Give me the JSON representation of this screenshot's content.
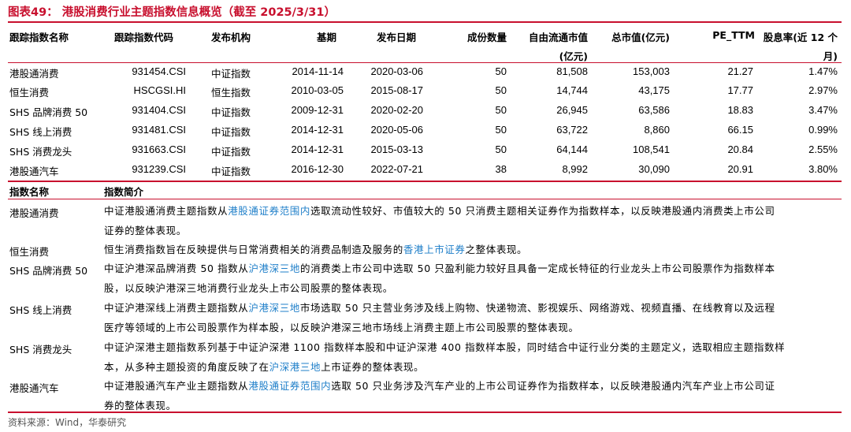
{
  "title": "图表49：  港股消费行业主题指数信息概览（截至 2025/3/31）",
  "headers": {
    "name": "跟踪指数名称",
    "code": "跟踪指数代码",
    "publisher": "发布机构",
    "base": "基期",
    "release": "发布日期",
    "count": "成份数量",
    "float_cap_1": "自由流通市值",
    "float_cap_2": "(亿元)",
    "total_cap": "总市值(亿元)",
    "pe": "PE_TTM",
    "yield_1": "股息率(近 12 个",
    "yield_2": "月)"
  },
  "rows": [
    {
      "name": "港股通消费",
      "code": "931454.CSI",
      "publisher": "中证指数",
      "base": "2014-11-14",
      "release": "2020-03-06",
      "count": "50",
      "float_cap": "81,508",
      "total_cap": "153,003",
      "pe": "21.27",
      "yield": "1.47%"
    },
    {
      "name": "恒生消费",
      "code": "HSCGSI.HI",
      "publisher": "恒生指数",
      "base": "2010-03-05",
      "release": "2015-08-17",
      "count": "50",
      "float_cap": "14,744",
      "total_cap": "43,175",
      "pe": "17.77",
      "yield": "2.97%"
    },
    {
      "name": "SHS 品牌消费 50",
      "code": "931404.CSI",
      "publisher": "中证指数",
      "base": "2009-12-31",
      "release": "2020-02-20",
      "count": "50",
      "float_cap": "26,945",
      "total_cap": "63,586",
      "pe": "18.83",
      "yield": "3.47%"
    },
    {
      "name": "SHS 线上消费",
      "code": "931481.CSI",
      "publisher": "中证指数",
      "base": "2014-12-31",
      "release": "2020-05-06",
      "count": "50",
      "float_cap": "63,722",
      "total_cap": "8,860",
      "pe": "66.15",
      "yield": "0.99%"
    },
    {
      "name": "SHS 消费龙头",
      "code": "931663.CSI",
      "publisher": "中证指数",
      "base": "2014-12-31",
      "release": "2015-03-13",
      "count": "50",
      "float_cap": "64,144",
      "total_cap": "108,541",
      "pe": "20.84",
      "yield": "2.55%"
    },
    {
      "name": "港股通汽车",
      "code": "931239.CSI",
      "publisher": "中证指数",
      "base": "2016-12-30",
      "release": "2022-07-21",
      "count": "38",
      "float_cap": "8,992",
      "total_cap": "30,090",
      "pe": "20.91",
      "yield": "3.80%"
    }
  ],
  "desc_headers": {
    "name": "指数名称",
    "intro": "指数简介"
  },
  "descriptions": [
    {
      "name": "港股通消费",
      "l1a": "中证港股通消费主题指数从",
      "l1h": "港股通证券范围内",
      "l1b": "选取流动性较好、市值较大的 50 只消费主题相关证券作为指数样本，以反映港股通内消费类上市公司",
      "l2a": "证券的整体表现。",
      "l2h": "",
      "l2b": ""
    },
    {
      "name": "恒生消费",
      "l1a": "恒生消费指数旨在反映提供与日常消费相关的消费品制造及服务的",
      "l1h": "香港上市证券",
      "l1b": "之整体表现。",
      "l2a": "",
      "l2h": "",
      "l2b": ""
    },
    {
      "name": "SHS 品牌消费 50",
      "l1a": "中证沪港深品牌消费 50 指数从",
      "l1h": "沪港深三地",
      "l1b": "的消费类上市公司中选取 50 只盈利能力较好且具备一定成长特征的行业龙头上市公司股票作为指数样本",
      "l2a": "股，以反映沪港深三地消费行业龙头上市公司股票的整体表现。",
      "l2h": "",
      "l2b": ""
    },
    {
      "name": "SHS 线上消费",
      "l1a": "中证沪港深线上消费主题指数从",
      "l1h": "沪港深三地",
      "l1b": "市场选取 50 只主营业务涉及线上购物、快递物流、影视娱乐、网络游戏、视频直播、在线教育以及远程",
      "l2a": "医疗等领域的上市公司股票作为样本股，以反映沪港深三地市场线上消费主题上市公司股票的整体表现。",
      "l2h": "",
      "l2b": ""
    },
    {
      "name": "SHS 消费龙头",
      "l1a": "中证沪深港主题指数系列基于中证沪深港 1100 指数样本股和中证沪深港 400 指数样本股，同时结合中证行业分类的主题定义，选取相应主题指数样",
      "l1h": "",
      "l1b": "",
      "l2a": "本，从多种主题投资的角度反映了在",
      "l2h": "沪深港三地",
      "l2b": "上市证券的整体表现。"
    },
    {
      "name": "港股通汽车",
      "l1a": "中证港股通汽车产业主题指数从",
      "l1h": "港股通证券范围内",
      "l1b": "选取 50 只业务涉及汽车产业的上市公司证券作为指数样本，以反映港股通内汽车产业上市公司证",
      "l2a": "券的整体表现。",
      "l2h": "",
      "l2b": ""
    }
  ],
  "source": "资料来源：Wind，华泰研究",
  "colors": {
    "accent": "#c8102e",
    "highlight": "#1f7fc9"
  }
}
